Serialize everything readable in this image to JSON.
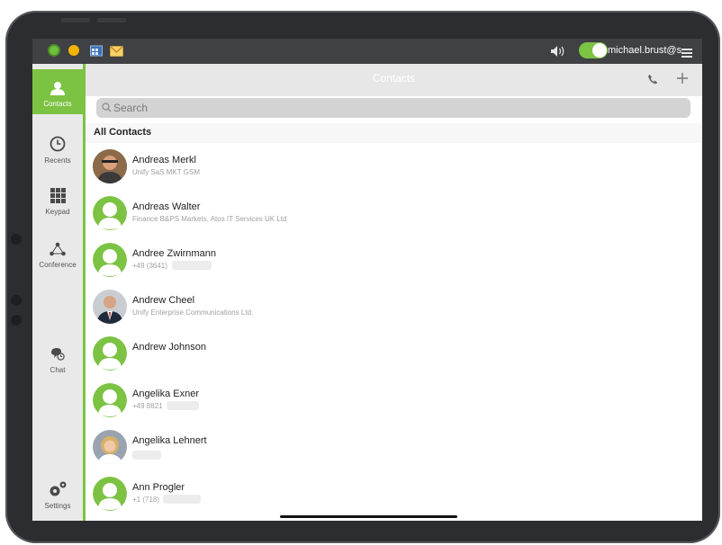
{
  "status_bar": {
    "username": "michael.brust@s",
    "toggle_on": true,
    "icons": [
      "green-status-icon",
      "yellow-status-icon",
      "calendar-icon",
      "mail-icon",
      "speaker-icon",
      "menu-icon"
    ]
  },
  "sidebar": {
    "items": [
      {
        "label": "Contacts",
        "icon": "person-icon",
        "active": true
      },
      {
        "label": "Recents",
        "icon": "clock-icon",
        "active": false
      },
      {
        "label": "Keypad",
        "icon": "keypad-icon",
        "active": false
      },
      {
        "label": "Conference",
        "icon": "conference-icon",
        "active": false
      },
      {
        "label": "Chat",
        "icon": "chat-icon",
        "active": false
      },
      {
        "label": "Settings",
        "icon": "gear-icon",
        "active": false
      }
    ]
  },
  "header": {
    "title": "Contacts",
    "search_placeholder": "Search"
  },
  "section_title": "All Contacts",
  "contacts": [
    {
      "name": "Andreas Merkl",
      "sub": "Unify SaS MKT GSM",
      "avatar": "photo"
    },
    {
      "name": "Andreas Walter",
      "sub": "Finance B&PS Markets, Atos IT Services UK Ltd",
      "avatar": "placeholder"
    },
    {
      "name": "Andree Zwirnmann",
      "sub": "+49 (3641)",
      "avatar": "placeholder"
    },
    {
      "name": "Andrew Cheel",
      "sub": "Unify Enterprise Communications Ltd.",
      "avatar": "photo"
    },
    {
      "name": "Andrew Johnson",
      "sub": "",
      "avatar": "placeholder"
    },
    {
      "name": "Angelika Exner",
      "sub": "+49 8821",
      "avatar": "placeholder"
    },
    {
      "name": "Angelika Lehnert",
      "sub": "",
      "avatar": "photo"
    },
    {
      "name": "Ann Progler",
      "sub": "+1 (718)",
      "avatar": "placeholder"
    }
  ],
  "colors": {
    "accent": "#7cc243",
    "topbar": "#3f4144",
    "sidebar": "#e9e9e9"
  }
}
